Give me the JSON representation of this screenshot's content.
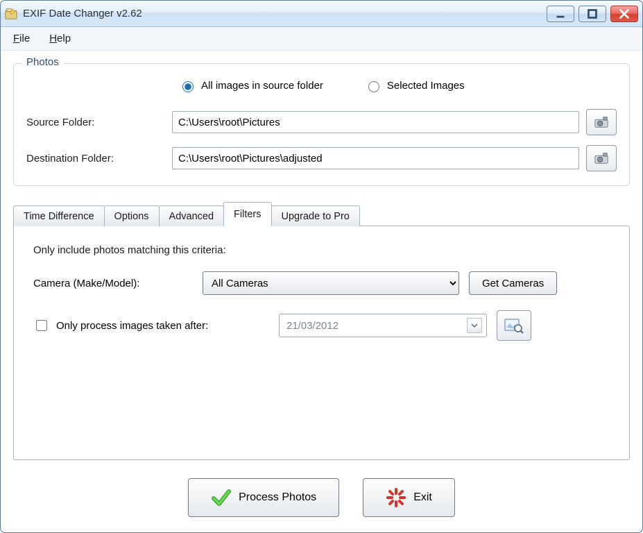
{
  "window": {
    "title": "EXIF Date Changer v2.62"
  },
  "menu": {
    "file": "File",
    "help": "Help"
  },
  "photos": {
    "legend": "Photos",
    "radio_all": "All images in source folder",
    "radio_selected": "Selected Images",
    "source_label": "Source Folder:",
    "source_value": "C:\\Users\\root\\Pictures",
    "dest_label": "Destination Folder:",
    "dest_value": "C:\\Users\\root\\Pictures\\adjusted"
  },
  "tabs": {
    "time_diff": "Time Difference",
    "options": "Options",
    "advanced": "Advanced",
    "filters": "Filters",
    "upgrade": "Upgrade to Pro",
    "active": "filters"
  },
  "filters": {
    "intro": "Only include photos matching this criteria:",
    "camera_label": "Camera (Make/Model):",
    "camera_value": "All Cameras",
    "get_cameras": "Get Cameras",
    "only_after_label": "Only process images taken after:",
    "only_after_checked": false,
    "date_value": "21/03/2012"
  },
  "footer": {
    "process": "Process Photos",
    "exit": "Exit"
  }
}
